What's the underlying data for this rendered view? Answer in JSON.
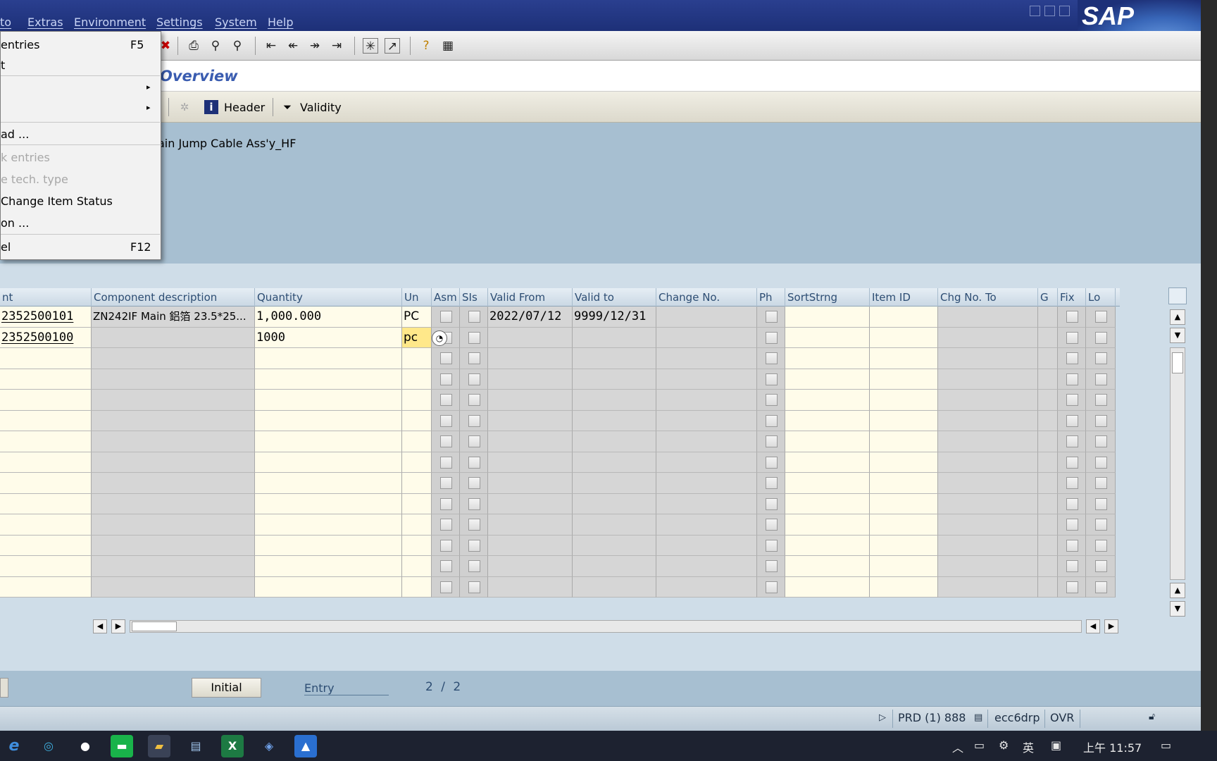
{
  "menubar": {
    "items": [
      "to",
      "Extras",
      "Environment",
      "Settings",
      "System",
      "Help"
    ]
  },
  "brand": {
    "logo_text": "SAP"
  },
  "title": {
    "text": "Overview"
  },
  "app_toolbar": {
    "header_label": "Header",
    "validity_label": "Validity"
  },
  "header": {
    "material_desc": "ain Jump Cable Ass'y_HF"
  },
  "dropdown": {
    "items": [
      {
        "label": "entries",
        "shortcut": "F5",
        "enabled": true
      },
      {
        "label": "t",
        "shortcut": "",
        "enabled": true
      },
      {
        "label": "",
        "shortcut": "",
        "enabled": true,
        "submenu": true
      },
      {
        "label": "",
        "shortcut": "",
        "enabled": true,
        "submenu": true
      },
      {
        "label": "ad ...",
        "shortcut": "",
        "enabled": true
      },
      {
        "label": "k entries",
        "shortcut": "",
        "enabled": false
      },
      {
        "label": "e tech. type",
        "shortcut": "",
        "enabled": false
      },
      {
        "label": "Change Item Status",
        "shortcut": "",
        "enabled": true
      },
      {
        "label": "on ...",
        "shortcut": "",
        "enabled": true
      },
      {
        "label": "el",
        "shortcut": "F12",
        "enabled": true
      }
    ]
  },
  "table": {
    "columns": [
      "nt",
      "Component description",
      "Quantity",
      "Un",
      "Asm",
      "SIs",
      "Valid From",
      "Valid to",
      "Change No.",
      "Ph",
      "SortStrng",
      "Item ID",
      "Chg No. To",
      "G",
      "Fix",
      "Lo"
    ],
    "rows": [
      {
        "component": "2352500101",
        "description": "ZN242IF Main 鋁箔 23.5*25...",
        "quantity": "1,000.000",
        "unit": "PC",
        "valid_from": "2022/07/12",
        "valid_to": "9999/12/31"
      },
      {
        "component": "2352500100",
        "description": "",
        "quantity": "1000",
        "unit": "pc",
        "valid_from": "",
        "valid_to": ""
      }
    ],
    "empty_row_count": 12
  },
  "footer": {
    "initial_button": "Initial",
    "entry_label": "Entry",
    "page_current": "2",
    "page_sep": "/",
    "page_total": "2"
  },
  "status": {
    "system": "PRD (1) 888",
    "server": "ecc6drp",
    "mode": "OVR"
  },
  "taskbar": {
    "ime": "英",
    "time": "上午 11:57"
  }
}
